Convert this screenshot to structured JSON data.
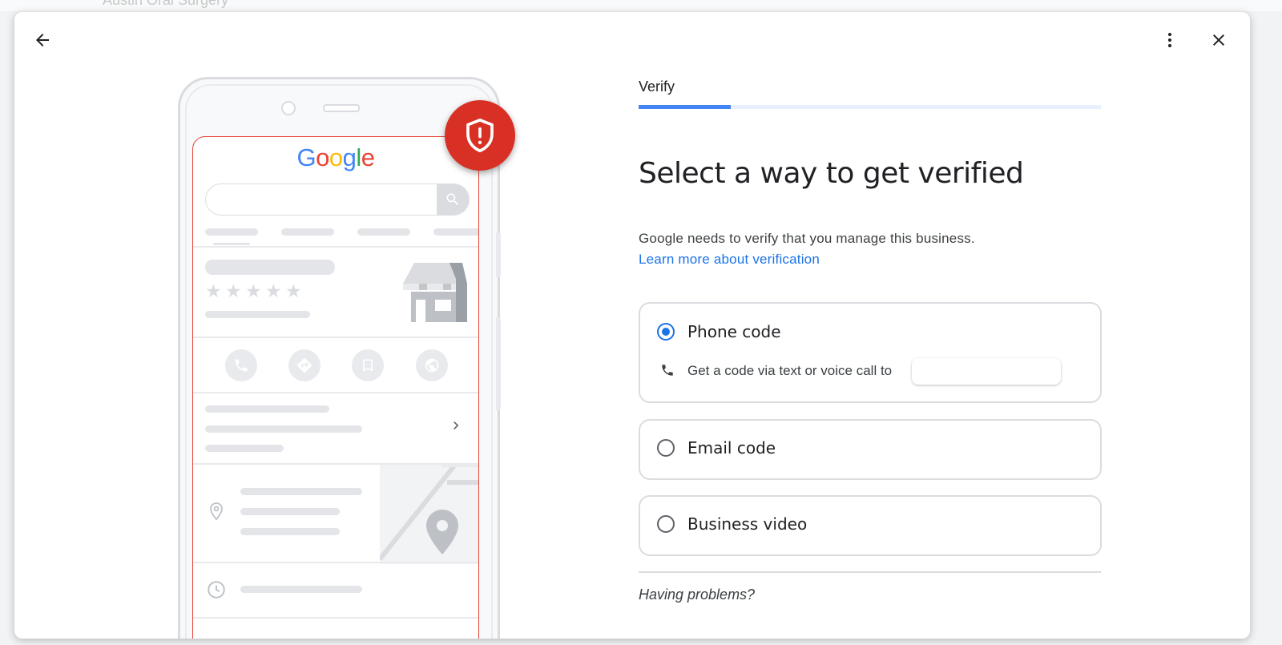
{
  "background": {
    "page_title": "Austin Oral Surgery"
  },
  "header": {
    "back_icon": "arrow-left-icon",
    "more_icon": "more-vert-icon",
    "close_icon": "close-icon"
  },
  "illustration": {
    "logo_text": [
      "G",
      "o",
      "o",
      "g",
      "l",
      "e"
    ],
    "logo_colors": [
      "#4285f4",
      "#ea4335",
      "#fbbc05",
      "#4285f4",
      "#34a853",
      "#ea4335"
    ],
    "badge_icon": "shield-alert-icon",
    "badge_color": "#d93025"
  },
  "verify": {
    "step_label": "Verify",
    "progress_fraction": 0.2,
    "title": "Select a way to get verified",
    "description": "Google needs to verify that you manage this business.",
    "learn_more": "Learn more about verification",
    "options": [
      {
        "label": "Phone code",
        "selected": true,
        "sub": "Get a code via text or voice call to"
      },
      {
        "label": "Email code",
        "selected": false
      },
      {
        "label": "Business video",
        "selected": false
      }
    ],
    "having_problems": "Having problems?"
  },
  "colors": {
    "accent": "#1a73e8",
    "progress": "#4285f4",
    "alert": "#d93025"
  }
}
